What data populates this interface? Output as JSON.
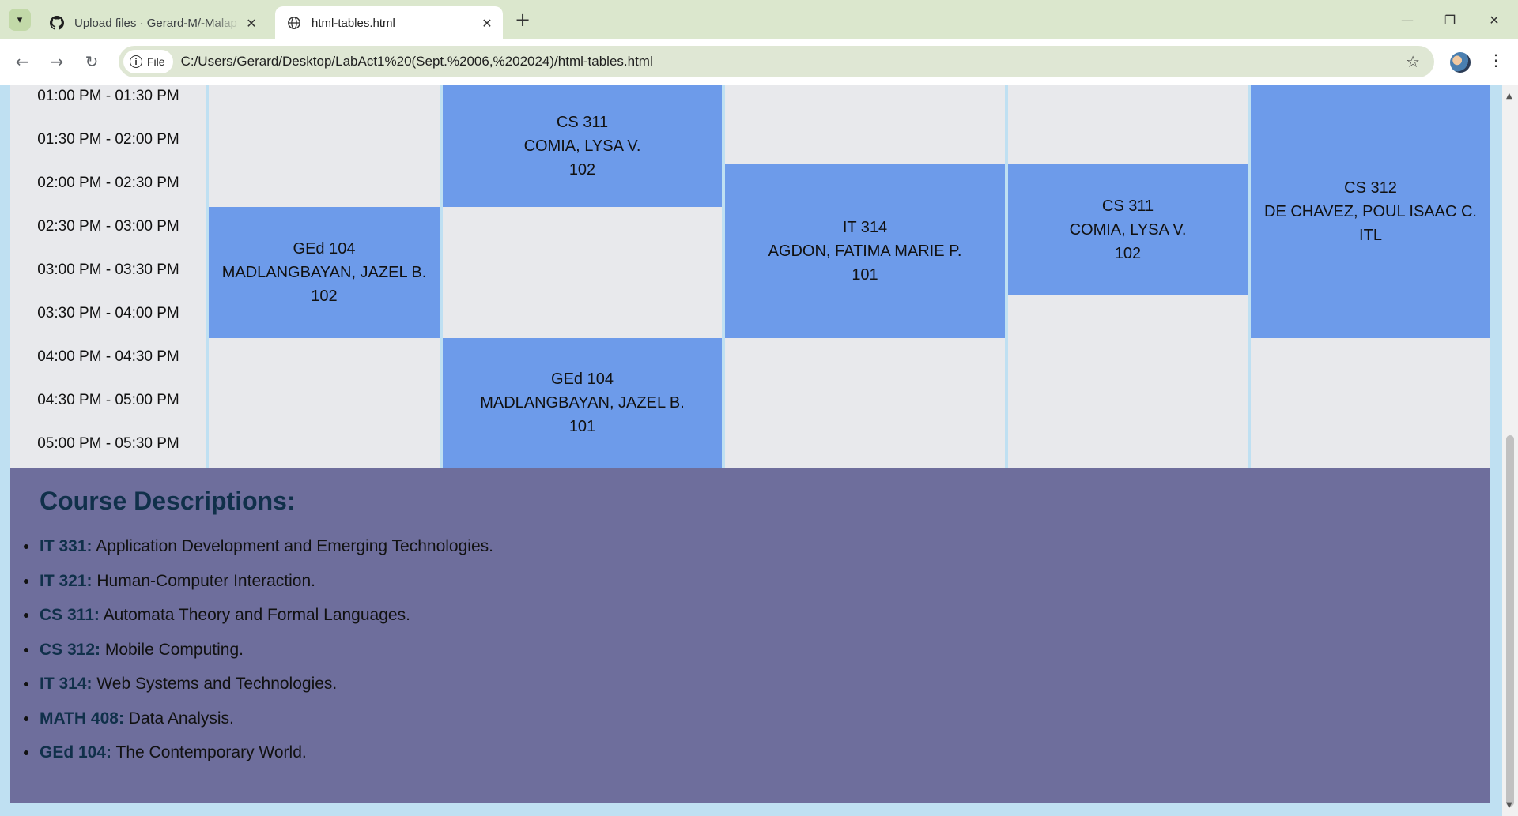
{
  "browser": {
    "tabs": [
      {
        "title": "Upload files · Gerard-M/-Malap",
        "active": false,
        "icon": "github-icon"
      },
      {
        "title": "html-tables.html",
        "active": true,
        "icon": "globe-icon"
      }
    ],
    "address": {
      "scheme_label": "File",
      "url": "C:/Users/Gerard/Desktop/LabAct1%20(Sept.%2006,%202024)/html-tables.html"
    }
  },
  "schedule": {
    "times": [
      "01:00 PM - 01:30 PM",
      "01:30 PM - 02:00 PM",
      "02:00 PM - 02:30 PM",
      "02:30 PM - 03:00 PM",
      "03:00 PM - 03:30 PM",
      "03:30 PM - 04:00 PM",
      "04:00 PM - 04:30 PM",
      "04:30 PM - 05:00 PM",
      "05:00 PM - 05:30 PM"
    ],
    "classes": [
      {
        "course": "CS 311",
        "instructor": "COMIA, LYSA V.",
        "room": "102"
      },
      {
        "course": "GEd 104",
        "instructor": "MADLANGBAYAN, JAZEL B.",
        "room": "102"
      },
      {
        "course": "GEd 104",
        "instructor": "MADLANGBAYAN, JAZEL B.",
        "room": "101"
      },
      {
        "course": "IT 314",
        "instructor": "AGDON, FATIMA MARIE P.",
        "room": "101"
      },
      {
        "course": "CS 311",
        "instructor": "COMIA, LYSA V.",
        "room": "102"
      },
      {
        "course": "CS 312",
        "instructor": "DE CHAVEZ, POUL ISAAC C.",
        "room": "ITL"
      }
    ]
  },
  "descriptions": {
    "title": "Course Descriptions:",
    "items": [
      {
        "code": "IT 331:",
        "text": " Application Development and Emerging Technologies."
      },
      {
        "code": "IT 321:",
        "text": " Human-Computer Interaction."
      },
      {
        "code": "CS 311:",
        "text": " Automata Theory and Formal Languages."
      },
      {
        "code": "CS 312:",
        "text": " Mobile Computing."
      },
      {
        "code": "IT 314:",
        "text": " Web Systems and Technologies."
      },
      {
        "code": "MATH 408:",
        "text": " Data Analysis."
      },
      {
        "code": "GEd 104:",
        "text": " The Contemporary World."
      }
    ]
  },
  "colors": {
    "class_block": "#6d9bea",
    "empty_cell": "#e8e9ec",
    "description_bg": "#6e6e9c",
    "heading": "#10304a"
  }
}
